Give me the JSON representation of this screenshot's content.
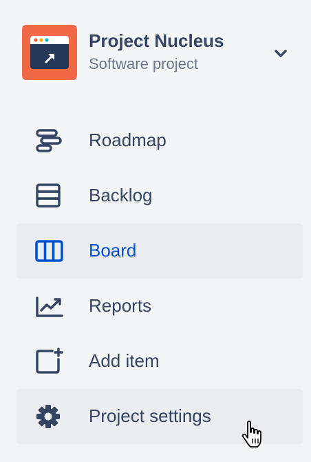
{
  "project": {
    "name": "Project Nucleus",
    "type": "Software project",
    "avatar_color": "#f26a45",
    "icon": "project-window-icon"
  },
  "nav": {
    "items": [
      {
        "label": "Roadmap",
        "icon": "roadmap-icon",
        "selected": false
      },
      {
        "label": "Backlog",
        "icon": "backlog-icon",
        "selected": false
      },
      {
        "label": "Board",
        "icon": "board-icon",
        "selected": true
      },
      {
        "label": "Reports",
        "icon": "reports-icon",
        "selected": false
      },
      {
        "label": "Add item",
        "icon": "add-item-icon",
        "selected": false
      },
      {
        "label": "Project settings",
        "icon": "gear-icon",
        "selected": false
      }
    ]
  },
  "colors": {
    "text": "#344563",
    "subtext": "#6b778c",
    "selected_text": "#0052cc",
    "selected_bg": "#ebecf0",
    "background": "#f4f5f7"
  }
}
